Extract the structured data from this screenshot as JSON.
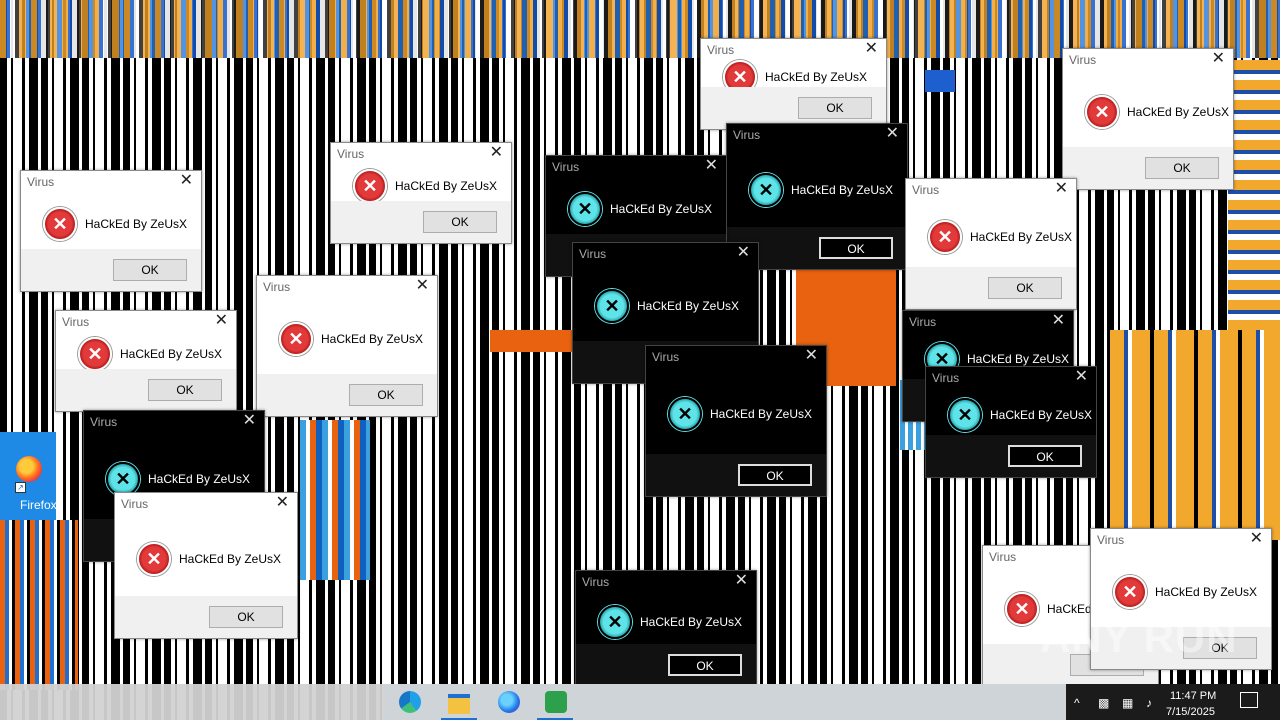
{
  "dialog_title": "Virus",
  "dialog_message": "HaCkEd By ZeUsX",
  "ok_label": "OK",
  "close_glyph": "✕",
  "error_glyph": "✕",
  "desktop": {
    "firefox_label": "Firefox",
    "shortcut_glyph": "↗"
  },
  "taskbar": {
    "apps": [
      "edge-icon",
      "file-explorer-icon",
      "firefox-icon",
      "app-icon"
    ],
    "tray": {
      "chevron": "^",
      "clock_time": "11:47 PM",
      "clock_date": "7/15/2025"
    }
  },
  "watermark": "ANY RUN",
  "colors": {
    "error_red": "#e23a3a",
    "dark_dialog_icon": "#5de3e8",
    "glitch_orange": "#e8620f",
    "glitch_yellow": "#f2a82c",
    "glitch_blue": "#1e5fd0"
  }
}
